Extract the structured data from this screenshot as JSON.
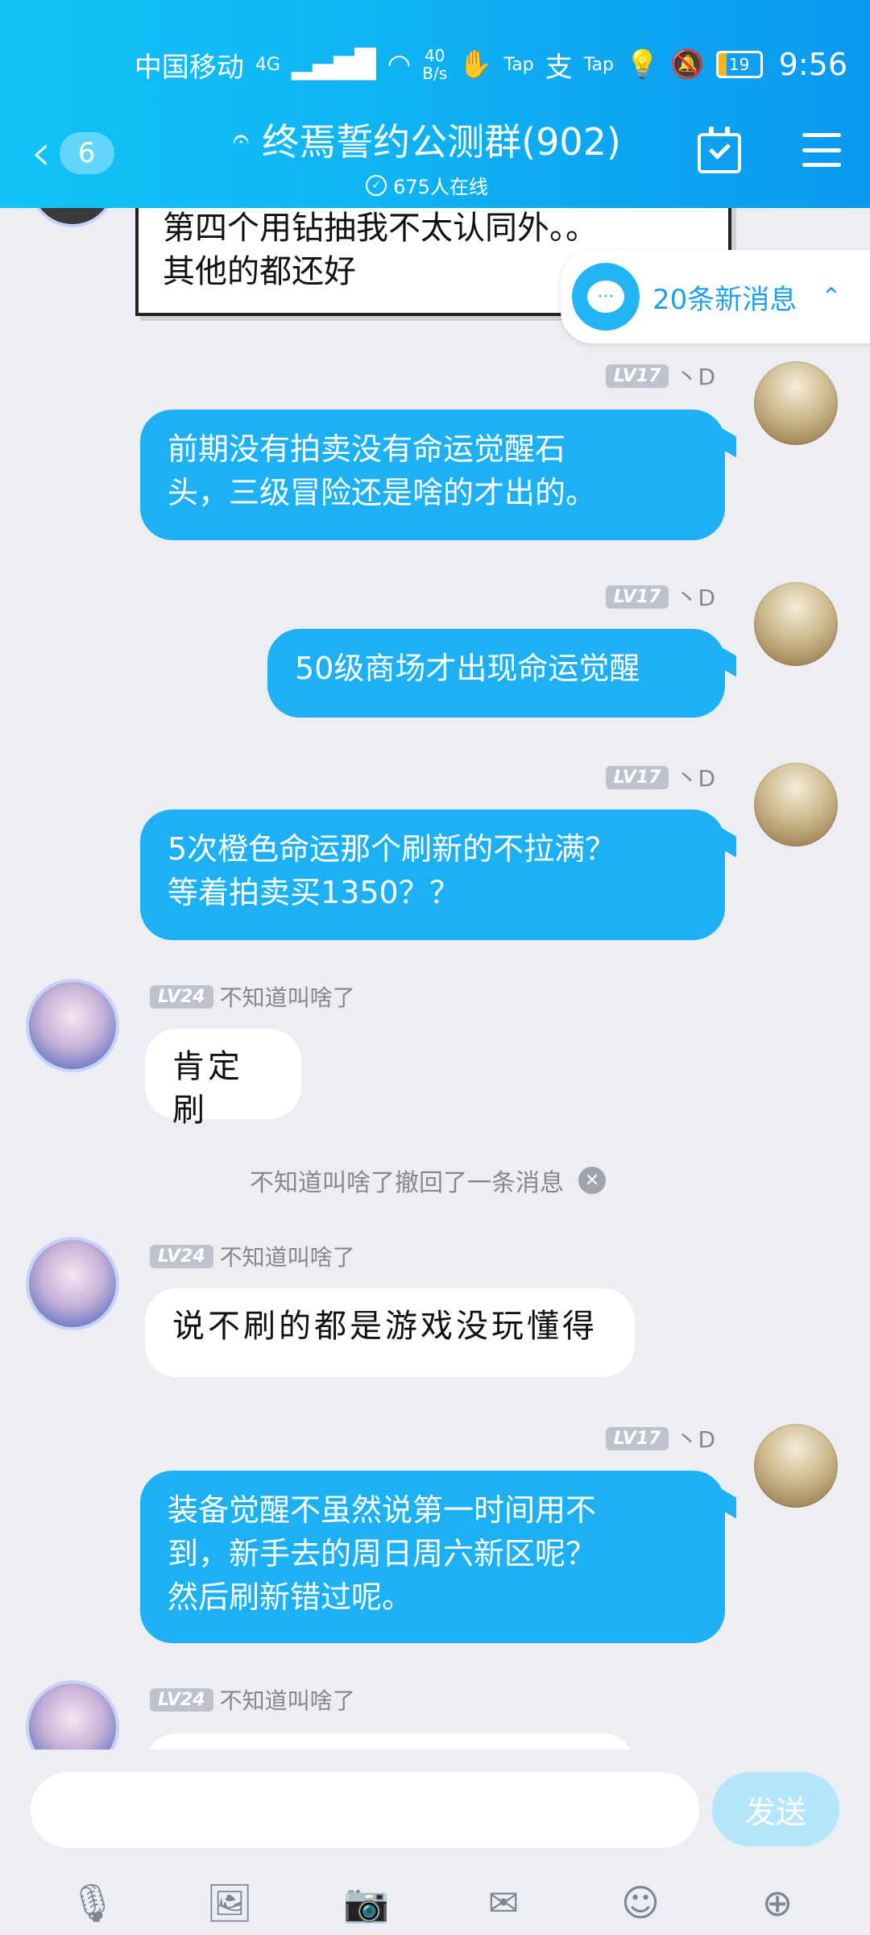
{
  "status_bar": {
    "carrier": "中国移动",
    "network": "4G",
    "speed_value": "40",
    "speed_unit": "B/s",
    "tap1": "Tap",
    "tap2": "Tap",
    "battery": "19",
    "time": "9:56"
  },
  "header": {
    "back_count": "6",
    "group_name": "终焉誓约公测群(902)",
    "online": "675人在线"
  },
  "new_messages_banner": "20条新消息",
  "messages": [
    {
      "type": "framed",
      "text_line1": "第四个用钻抽我不太认同外。。",
      "text_line2": "其他的都还好"
    },
    {
      "type": "me",
      "level": "LV17",
      "sender": "丶D",
      "line1": "前期没有拍卖没有命运觉醒石",
      "line2": "头，三级冒险还是啥的才出的。"
    },
    {
      "type": "me",
      "level": "LV17",
      "sender": "丶D",
      "line1": "50级商场才出现命运觉醒"
    },
    {
      "type": "me",
      "level": "LV17",
      "sender": "丶D",
      "line1": "5次橙色命运那个刷新的不拉满？",
      "line2": "等着拍卖买1350？？"
    },
    {
      "type": "other",
      "level": "LV24",
      "sender": "不知道叫啥了",
      "line1": "肯定刷"
    },
    {
      "type": "recall",
      "text": "不知道叫啥了撤回了一条消息"
    },
    {
      "type": "other",
      "level": "LV24",
      "sender": "不知道叫啥了",
      "line1": "说不刷的都是游戏没玩懂得"
    },
    {
      "type": "me",
      "level": "LV17",
      "sender": "丶D",
      "line1": "装备觉醒不虽然说第一时间用不",
      "line2": "到，新手去的周日周六新区呢？",
      "line3": "然后刷新错过呢。"
    },
    {
      "type": "other",
      "level": "LV24",
      "sender": "不知道叫啥了",
      "line1": ""
    }
  ],
  "composer": {
    "placeholder": "",
    "send_label": "发送"
  },
  "toolbar": [
    "microphone-icon",
    "image-icon",
    "camera-icon",
    "red-packet-icon",
    "emoji-icon",
    "plus-icon"
  ],
  "colors": {
    "accent": "#1EB0F5",
    "header": "#0FB3F3",
    "background": "#ECEEF3"
  }
}
